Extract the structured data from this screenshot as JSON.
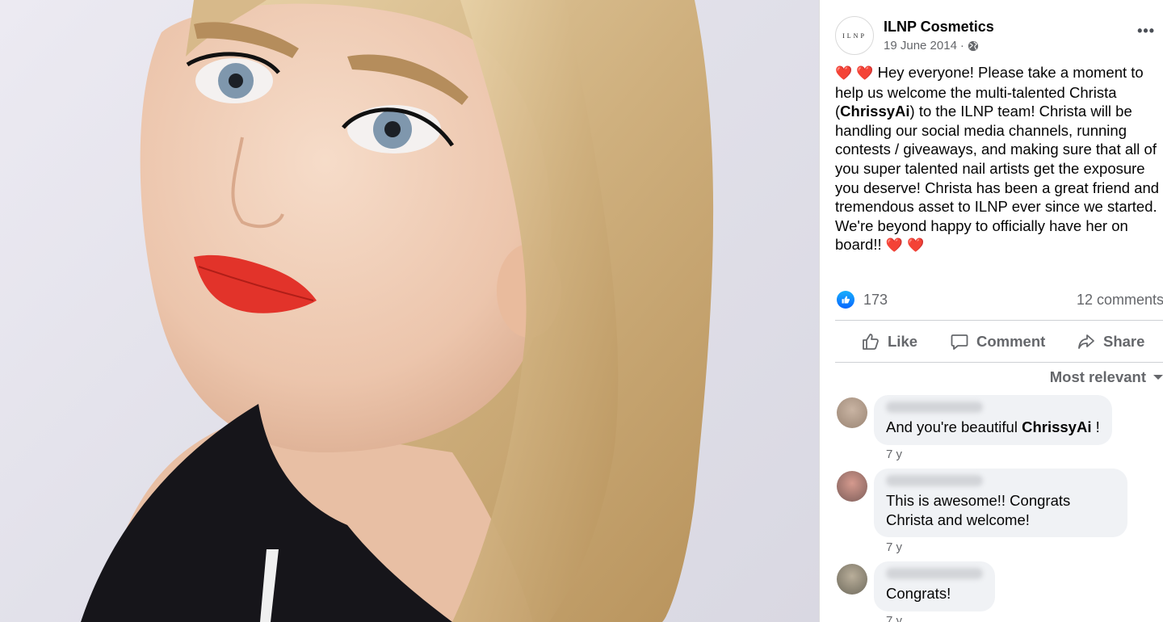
{
  "post": {
    "page_name": "ILNP Cosmetics",
    "avatar_logo_text": "ILNP",
    "date": "19 June 2014",
    "date_separator": "·",
    "audience_icon": "globe-icon",
    "more_icon": "more-options-icon",
    "text_intro": "Hey everyone! Please take a moment to help us welcome the multi-talented Christa (",
    "mention": "ChrissyAi",
    "text_rest": ") to the ILNP team! Christa will be handling our social media channels, running contests / giveaways, and making sure that all of you super talented nail artists get the exposure you deserve! Christa has been a great friend and tremendous asset to ILNP ever since we started. We're beyond happy to officially have her on board!!",
    "heart_emoji": "❤️"
  },
  "reactions": {
    "like_count": "173",
    "comment_count": "12 comments"
  },
  "actions": {
    "like": "Like",
    "comment": "Comment",
    "share": "Share"
  },
  "comments_sort": "Most relevant",
  "comments": [
    {
      "text_before": "And you're beautiful ",
      "mention": "ChrissyAi",
      "text_after": " !",
      "time": "7 y"
    },
    {
      "text_before": "This is awesome!! Congrats Christa and welcome!",
      "mention": "",
      "text_after": "",
      "time": "7 y"
    },
    {
      "text_before": "Congrats!",
      "mention": "",
      "text_after": "",
      "time": "7 y"
    }
  ],
  "colors": {
    "facebook_blue": "#0866ff",
    "secondary_text": "#65676b",
    "bubble": "#f0f2f5",
    "heart": "#e0245e"
  }
}
